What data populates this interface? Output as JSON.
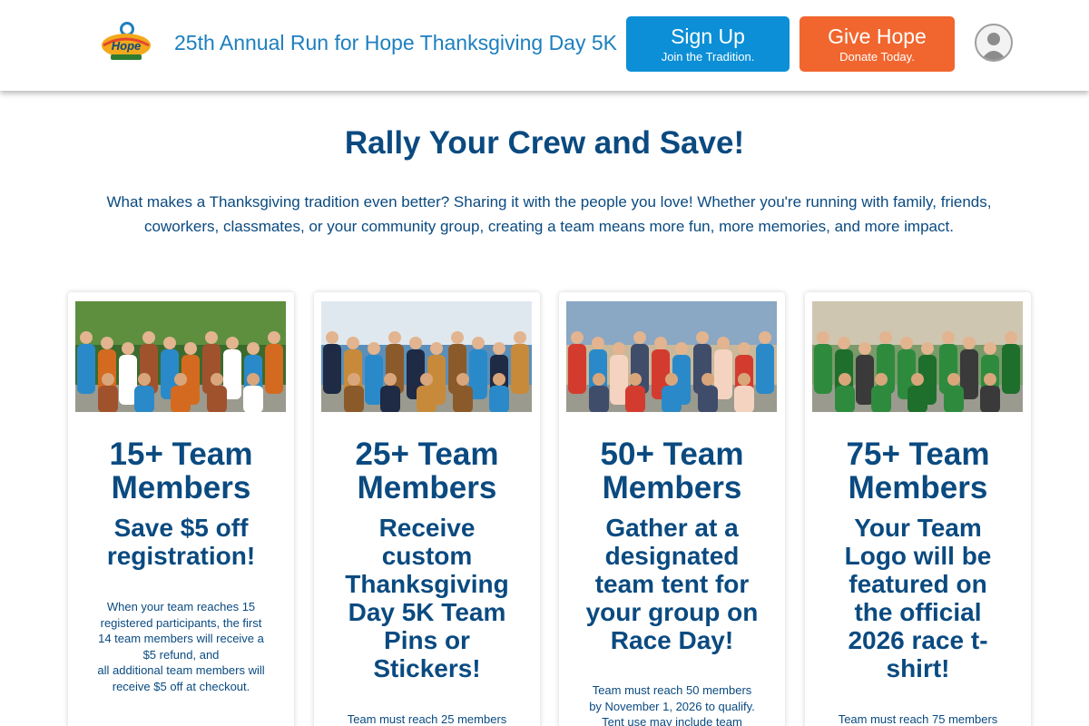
{
  "header": {
    "logo_text": "Run for Hope",
    "site_title": "25th Annual Run for Hope Thanksgiving Day 5K",
    "signup": {
      "label": "Sign Up",
      "sub": "Join the Tradition."
    },
    "give": {
      "label": "Give Hope",
      "sub": "Donate Today."
    },
    "avatar_icon": "user-avatar-icon"
  },
  "colors": {
    "brand_blue": "#0a4a80",
    "title_blue": "#1d7fbf",
    "signup_blue": "#0c8fd6",
    "give_orange": "#f1662e"
  },
  "main": {
    "title": "Rally Your Crew and Save!",
    "intro_line1": "What makes a Thanksgiving tradition even better? Sharing it with the people you love! Whether you're running with family, friends,",
    "intro_line2": "coworkers, classmates, or your community group, creating a team means more fun, more memories, and more impact."
  },
  "cards": [
    {
      "heading": [
        "15+ Team",
        "Members"
      ],
      "perk": [
        "Save $5 off",
        "registration!"
      ],
      "note": [
        "When your team reaches 15",
        "registered participants, the first",
        "14 team members will receive a",
        "$5 refund, and",
        "all additional team members will",
        "receive $5 off at checkout."
      ]
    },
    {
      "heading": [
        "25+ Team",
        "Members"
      ],
      "perk": [
        "Receive",
        "custom",
        "Thanksgiving",
        "Day 5K Team",
        "Pins or",
        "Stickers!"
      ],
      "note": [
        "Team must reach 25 members"
      ]
    },
    {
      "heading": [
        "50+ Team",
        "Members"
      ],
      "perk": [
        "Gather at a",
        "designated",
        "team tent for",
        "your group on",
        "Race Day!"
      ],
      "note": [
        "Team must reach 50 members",
        "by November 1, 2026 to qualify.",
        "Tent use may include team"
      ]
    },
    {
      "heading": [
        "75+ Team",
        "Members"
      ],
      "perk": [
        "Your Team",
        "Logo will be",
        "featured on",
        "the official",
        "2026 race t-",
        "shirt!"
      ],
      "note": [
        "Team must reach 75 members"
      ]
    }
  ]
}
